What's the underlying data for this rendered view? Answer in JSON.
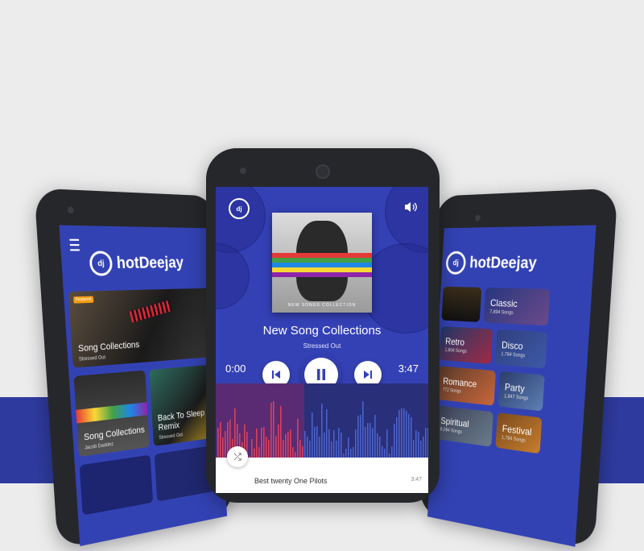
{
  "brand": {
    "name": "hotDeejay",
    "badge": "dj"
  },
  "left_screen": {
    "featured": {
      "tag": "Featured",
      "title": "Song Collections",
      "subtitle": "Stressed Out"
    },
    "cards": [
      {
        "title": "Song Collections",
        "subtitle": "Jacob Daddez"
      },
      {
        "title": "Back To Sleep Remix",
        "subtitle": "Stressed Out"
      }
    ]
  },
  "player": {
    "album_text": "NEW SONGS COLLECTION",
    "title": "New Song Collections",
    "artist": "Stressed Out",
    "time_current": "0:00",
    "time_total": "3:47",
    "next_track": {
      "title": "Best twenty One Pilots",
      "duration": "3:47"
    }
  },
  "right_screen": {
    "genres": [
      {
        "name": "Classic",
        "count": "7,894 Songs"
      },
      {
        "name": "Retro",
        "count": "1,804 Songs"
      },
      {
        "name": "Disco",
        "count": "1,784 Songs"
      },
      {
        "name": "Romance",
        "count": "772 Songs"
      },
      {
        "name": "Party",
        "count": "1,847 Songs"
      },
      {
        "name": "Spiritual",
        "count": "6,084 Songs"
      },
      {
        "name": "Festival",
        "count": "1,784 Songs"
      }
    ]
  },
  "colors": {
    "accent": "#3441b5",
    "band": "#2e3a9e",
    "background": "#ececed"
  }
}
